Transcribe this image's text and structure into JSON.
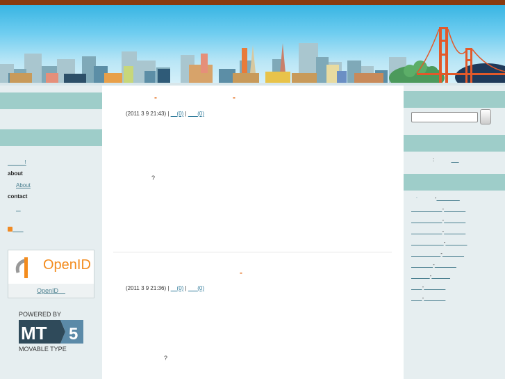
{
  "header": {
    "banner": "city-skyline-with-golden-gate-bridge"
  },
  "colors": {
    "top_bar": "#8a3a0e",
    "band": "#9ecdc9",
    "accent": "#e46d1a",
    "link": "#4a7f8f"
  },
  "entries": [
    {
      "title_marks": [
        "-",
        "-"
      ],
      "date": "(2011 3 9 21:43) |",
      "link1": "(0)",
      "sep": "|",
      "link2": "(0)",
      "body_mark": "?"
    },
    {
      "title_marks": [
        "-"
      ],
      "date": "(2011 3 9 21:36) |",
      "link1": "(0)",
      "sep": "|",
      "link2": "(0)",
      "body_mark": "?"
    }
  ],
  "left_sidebar": {
    "link1": "!",
    "about_heading": "about",
    "about_link": "About",
    "contact_heading": "contact",
    "contact_link": "",
    "feed_link": "",
    "openid_logo": "OpenID",
    "openid_link": "OpenID",
    "powered_by": "POWERED BY",
    "mt_logo": "MT",
    "mt_version": "5",
    "mt_name": "MOVABLE TYPE"
  },
  "right_sidebar": {
    "search_placeholder": "",
    "status_colon": ":",
    "recent_items": [
      "-",
      "-",
      "-",
      "-",
      "-",
      "-",
      "-",
      "-",
      "-",
      "-"
    ]
  }
}
